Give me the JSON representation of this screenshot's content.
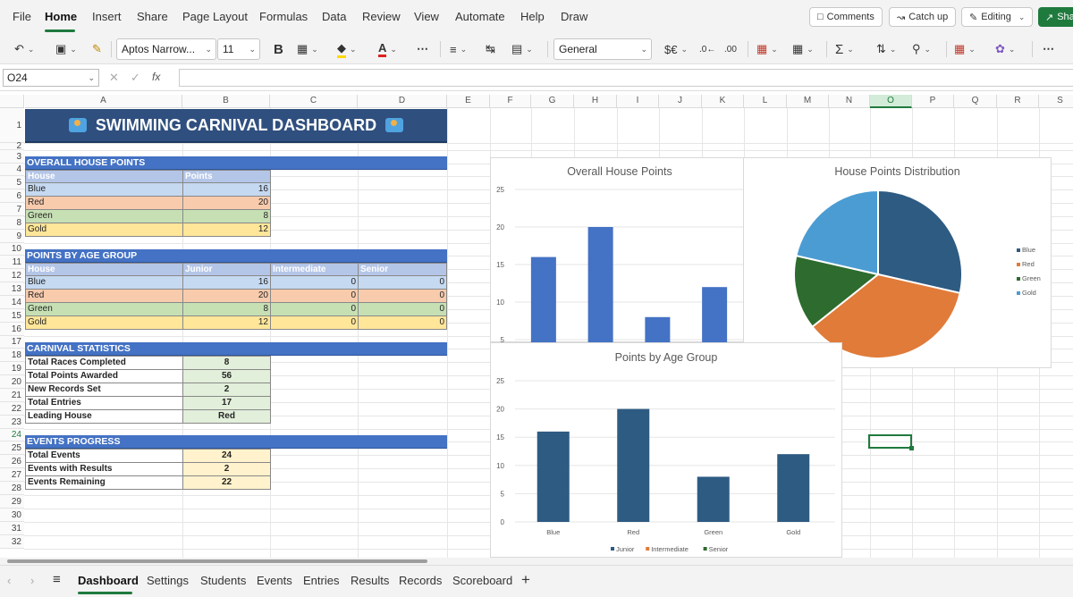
{
  "menu": {
    "items": [
      "File",
      "Home",
      "Insert",
      "Share",
      "Page Layout",
      "Formulas",
      "Data",
      "Review",
      "View",
      "Automate",
      "Help",
      "Draw"
    ],
    "active": "Home",
    "comments": "Comments",
    "catchup": "Catch up",
    "editing": "Editing",
    "share": "Sha"
  },
  "toolbar": {
    "font_name": "Aptos Narrow...",
    "font_size": "11",
    "number_format": "General",
    "bold": "B"
  },
  "formula": {
    "name_box": "O24",
    "fx": "fx",
    "value": ""
  },
  "columns": [
    "A",
    "B",
    "C",
    "D",
    "E",
    "F",
    "G",
    "H",
    "I",
    "J",
    "K",
    "L",
    "M",
    "N",
    "O",
    "P",
    "Q",
    "R",
    "S"
  ],
  "rows": [
    "1",
    "2",
    "3",
    "4",
    "5",
    "6",
    "7",
    "8",
    "9",
    "10",
    "11",
    "12",
    "13",
    "14",
    "15",
    "16",
    "17",
    "18",
    "19",
    "20",
    "21",
    "22",
    "23",
    "24",
    "25",
    "26",
    "27",
    "28",
    "29",
    "30",
    "31",
    "32"
  ],
  "dashboard": {
    "title": "SWIMMING CARNIVAL DASHBOARD",
    "overall": {
      "section": "OVERALL HOUSE POINTS",
      "headers": [
        "House",
        "Points"
      ],
      "rows": [
        {
          "house": "Blue",
          "points": "16"
        },
        {
          "house": "Red",
          "points": "20"
        },
        {
          "house": "Green",
          "points": "8"
        },
        {
          "house": "Gold",
          "points": "12"
        }
      ]
    },
    "age": {
      "section": "POINTS BY AGE GROUP",
      "headers": [
        "House",
        "Junior",
        "Intermediate",
        "Senior"
      ],
      "rows": [
        {
          "house": "Blue",
          "junior": "16",
          "intermediate": "0",
          "senior": "0"
        },
        {
          "house": "Red",
          "junior": "20",
          "intermediate": "0",
          "senior": "0"
        },
        {
          "house": "Green",
          "junior": "8",
          "intermediate": "0",
          "senior": "0"
        },
        {
          "house": "Gold",
          "junior": "12",
          "intermediate": "0",
          "senior": "0"
        }
      ]
    },
    "stats": {
      "section": "CARNIVAL STATISTICS",
      "rows": [
        {
          "label": "Total Races Completed",
          "value": "8"
        },
        {
          "label": "Total Points Awarded",
          "value": "56"
        },
        {
          "label": "New Records Set",
          "value": "2"
        },
        {
          "label": "Total Entries",
          "value": "17"
        },
        {
          "label": "Leading House",
          "value": "Red"
        }
      ]
    },
    "progress": {
      "section": "EVENTS PROGRESS",
      "rows": [
        {
          "label": "Total Events",
          "value": "24"
        },
        {
          "label": "Events with Results",
          "value": "2"
        },
        {
          "label": "Events Remaining",
          "value": "22"
        }
      ]
    }
  },
  "colors": {
    "blue_row": "#c5d9f1",
    "red_row": "#f8cbad",
    "green_row": "#c6e0b4",
    "gold_row": "#ffe699",
    "stats_value": "#e2efda",
    "progress_value": "#fff2cc",
    "section": "#4472c4",
    "accent": "#1f7a3e"
  },
  "chart_data": [
    {
      "type": "bar",
      "title": "Overall House Points",
      "categories": [
        "Blue",
        "Red",
        "Green",
        "Gold"
      ],
      "values": [
        16,
        20,
        8,
        12
      ],
      "ylim": [
        0,
        25
      ],
      "yticks": [
        5,
        10,
        15,
        20,
        25
      ],
      "color": "#4472c4"
    },
    {
      "type": "pie",
      "title": "House Points Distribution",
      "labels": [
        "Blue",
        "Red",
        "Green",
        "Gold"
      ],
      "values": [
        16,
        20,
        8,
        12
      ],
      "colors": [
        "#2e5b82",
        "#e07b39",
        "#2e6b2e",
        "#4b9cd3"
      ],
      "legend": "right"
    },
    {
      "type": "bar",
      "title": "Points by Age Group",
      "categories": [
        "Blue",
        "Red",
        "Green",
        "Gold"
      ],
      "series": [
        {
          "name": "Junior",
          "values": [
            16,
            20,
            8,
            12
          ],
          "color": "#2e5b82"
        },
        {
          "name": "Intermediate",
          "values": [
            0,
            0,
            0,
            0
          ],
          "color": "#e07b39"
        },
        {
          "name": "Senior",
          "values": [
            0,
            0,
            0,
            0
          ],
          "color": "#2e6b2e"
        }
      ],
      "ylim": [
        0,
        25
      ],
      "yticks": [
        0,
        5,
        10,
        15,
        20,
        25
      ],
      "legend": "bottom"
    }
  ],
  "sheets": [
    "Dashboard",
    "Settings",
    "Students",
    "Events",
    "Entries",
    "Results",
    "Records",
    "Scoreboard"
  ],
  "active_sheet": "Dashboard"
}
